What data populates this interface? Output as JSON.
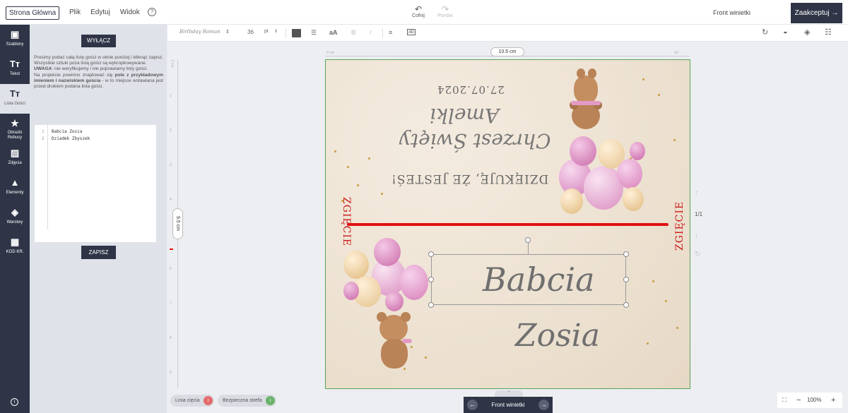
{
  "topbar": {
    "home_label": "Strona Główna",
    "menu": [
      "Plik",
      "Edytuj",
      "Widok"
    ],
    "help": "?",
    "undo_label": "Cofnij",
    "redo_label": "Ponów",
    "page_name": "Front winietki",
    "accept_label": "Zaakceptuj"
  },
  "nav": [
    {
      "label": "Szablony",
      "icon": "template-icon"
    },
    {
      "label": "Tekst",
      "icon": "text-icon"
    },
    {
      "label": "Lista Gości",
      "icon": "guest-list-icon"
    },
    {
      "label": "Obrazki Rebusy",
      "icon": "star-icon"
    },
    {
      "label": "Zdjęcia",
      "icon": "image-icon"
    },
    {
      "label": "Elementy",
      "icon": "shapes-icon"
    },
    {
      "label": "Warstwy",
      "icon": "layers-icon"
    },
    {
      "label": "KOD KR.",
      "icon": "qr-code-icon"
    }
  ],
  "panel": {
    "off_label": "WYŁĄCZ",
    "intro": "Prosimy podać całą listę gości w oknie poniżej i kliknąć zapisz. Wszystkie sztuki poza listą gości są wykropkowywane.",
    "warning_label": "UWAGA",
    "warning_text": ": nie weryfikujemy i nie poprawiamy listy gości.",
    "note_pre": "Na projekcie powinno znajdować się ",
    "note_bold": "pole z przykładowym imieniem i nazwiskiem gościa",
    "note_post": " - w to miejsce wstawiana jest przed drukiem podana lista gości.",
    "lines": [
      "Babcia Zosia",
      "Dziadek Zbyszek"
    ],
    "line_numbers": [
      "1",
      "2"
    ],
    "save_label": "ZAPISZ"
  },
  "format": {
    "font": "Birthday Roman",
    "size": "36",
    "unit": "pt"
  },
  "rulers": {
    "width_label": "10.5 cm",
    "height_label": "9.5 cm",
    "top_start": "0 cm",
    "top_end": "10",
    "left_ticks": [
      "0 cm",
      "1",
      "2",
      "3",
      "4",
      "5",
      "6",
      "7",
      "8",
      "9"
    ]
  },
  "card": {
    "fold_label": "ZGIĘCIE",
    "thanks": "DZIĘKUJĘ, ŻE JESTEŚ!",
    "holiday": "Chrzest Święty",
    "name": "Amelki",
    "date": "27.07.2024",
    "guest_first": "Babcia",
    "guest_last": "Zosia"
  },
  "side": {
    "pager": "1/1"
  },
  "bottom": {
    "cut_line": "Linia cięcia",
    "safe_zone": "Bezpieczna strefa",
    "page_label": "Front winietki",
    "zoom": "100%"
  },
  "colors": {
    "dark": "#2f3447",
    "fold": "#e01010",
    "card_border": "#5aa35a"
  }
}
